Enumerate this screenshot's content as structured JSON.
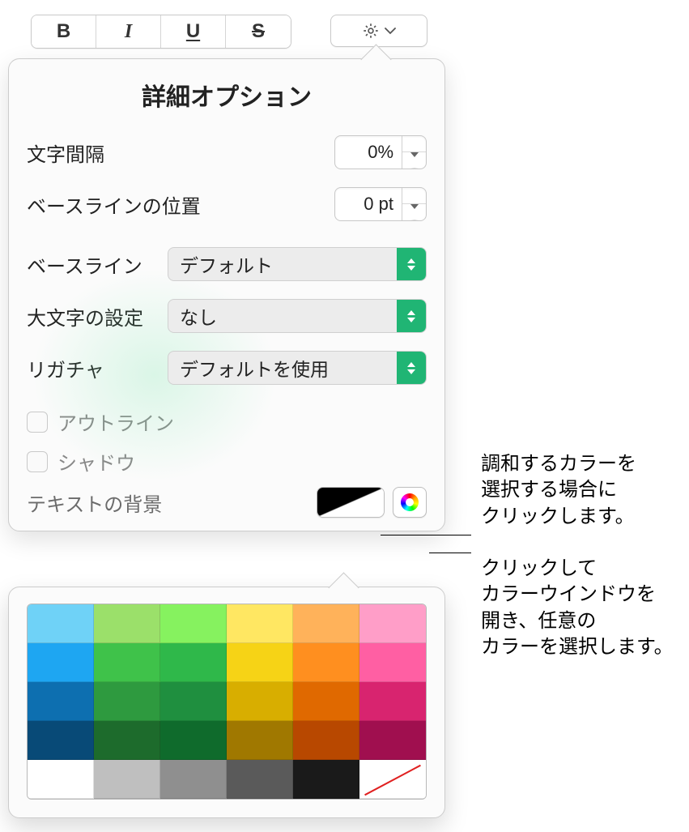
{
  "toolbar": {
    "bold_glyph": "B",
    "italic_glyph": "I",
    "underline_glyph": "U",
    "strike_glyph": "S"
  },
  "panel": {
    "title": "詳細オプション",
    "char_spacing_label": "文字間隔",
    "char_spacing_value": "0%",
    "baseline_shift_label": "ベースラインの位置",
    "baseline_shift_value": "0 pt",
    "baseline_label": "ベースライン",
    "baseline_value": "デフォルト",
    "caps_label": "大文字の設定",
    "caps_value": "なし",
    "ligature_label": "リガチャ",
    "ligature_value": "デフォルトを使用",
    "outline_label": "アウトライン",
    "shadow_label": "シャドウ",
    "text_bg_label": "テキストの背景"
  },
  "color_grid": {
    "rows": [
      [
        "#6fd2f7",
        "#9be06a",
        "#86f25f",
        "#ffe762",
        "#ffb25a",
        "#ff9ec8"
      ],
      [
        "#1ea6f2",
        "#3fc24a",
        "#2fb84a",
        "#f6d316",
        "#ff8f1f",
        "#ff5fa3"
      ],
      [
        "#0d6fb0",
        "#2e9a3f",
        "#1f8f3f",
        "#d8ae00",
        "#e06900",
        "#d8246f"
      ],
      [
        "#084a77",
        "#1d6b2c",
        "#0f6b2c",
        "#a07800",
        "#b84800",
        "#a00f4f"
      ],
      [
        "#ffffff",
        "#bfbfbf",
        "#8f8f8f",
        "#5a5a5a",
        "#1a1a1a",
        "no-color"
      ]
    ]
  },
  "callouts": {
    "swatch": "調和するカラーを\n選択する場合に\nクリックします。",
    "wheel": "クリックして\nカラーウインドウを\n開き、任意の\nカラーを選択します。"
  }
}
